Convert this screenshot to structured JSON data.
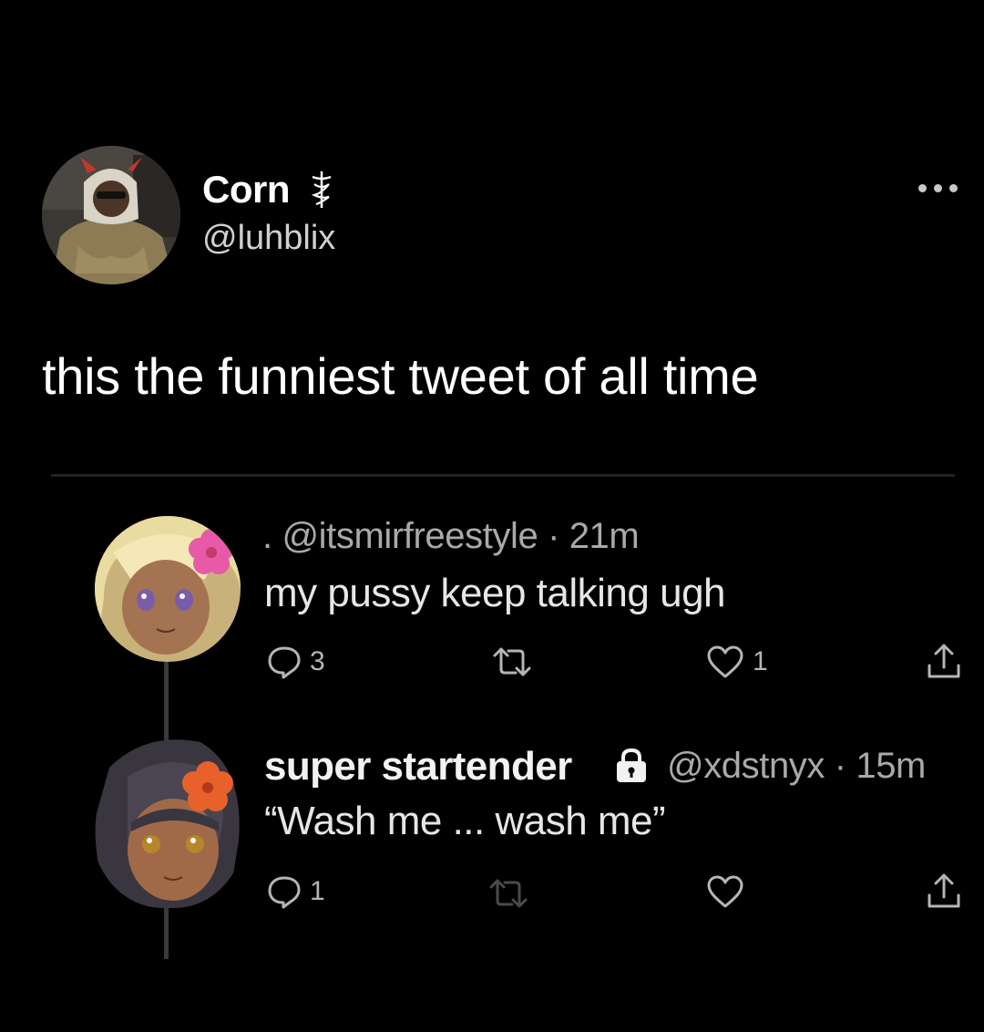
{
  "tweet": {
    "author_name": "Corn",
    "author_handle": "@luhblix",
    "text": "this the funniest tweet of all time",
    "more_icon": "ellipsis-icon",
    "verified_icon": "caduceus-icon"
  },
  "thread": [
    {
      "prefix": ".",
      "handle": "@itsmirfreestyle",
      "time": "· 21m",
      "text": "my pussy keep talking ugh",
      "actions": {
        "reply_count": "3",
        "retweet_count": "",
        "like_count": "1"
      }
    },
    {
      "name": "super startender",
      "protected_icon": "lock-icon",
      "handle": "@xdstnyx",
      "time": "· 15m",
      "text": "“Wash me ... wash me”",
      "actions": {
        "reply_count": "1",
        "retweet_count": "",
        "like_count": ""
      }
    }
  ],
  "colors": {
    "background": "#000000",
    "primary_text": "#ffffff",
    "secondary_text": "#a9a9a9",
    "divider": "#222222",
    "retweet_disabled": "#4a4a4a"
  }
}
